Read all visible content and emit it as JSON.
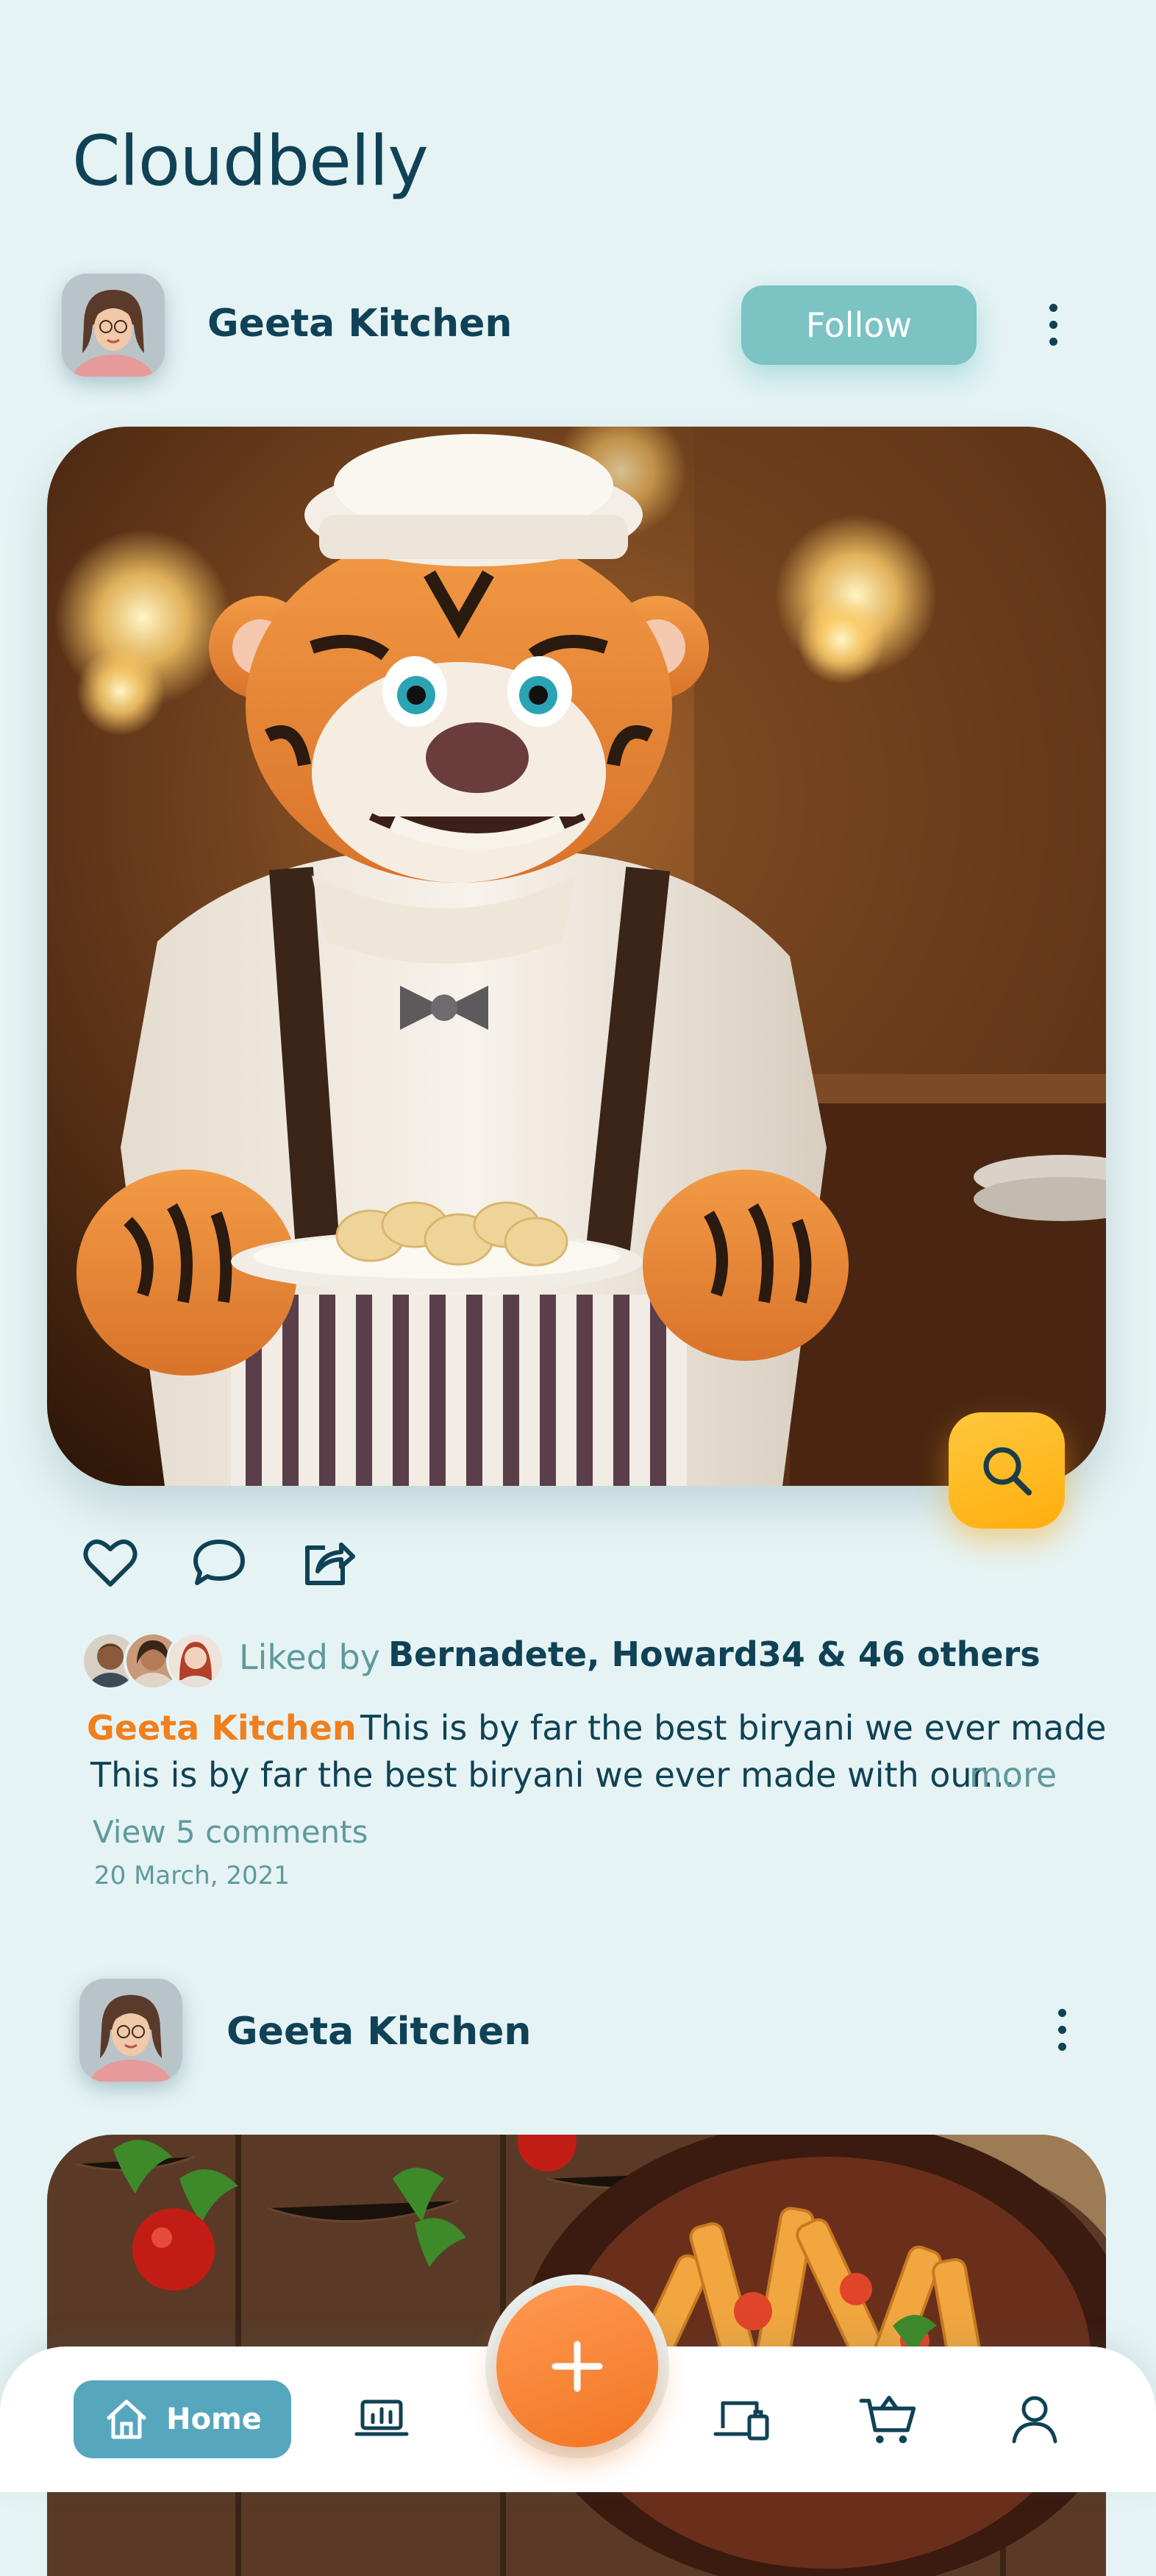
{
  "app": {
    "title": "Cloudbelly"
  },
  "post1": {
    "author": "Geeta Kitchen",
    "follow_label": "Follow",
    "likes": {
      "prefix": "Liked by",
      "names": "Bernadete, Howard34 & 46 others"
    },
    "caption": {
      "author": "Geeta Kitchen",
      "title": "This is by far the best biryani we ever made",
      "body": "This is by far the best biryani we ever made with our...",
      "more": "more"
    },
    "comments_link": "View 5 comments",
    "date": "20 March, 2021"
  },
  "post2": {
    "author": "Geeta Kitchen"
  },
  "nav": {
    "home_label": "Home"
  },
  "colors": {
    "background": "#e6f3f4",
    "primary_text": "#0f4256",
    "accent_orange": "#f07f1d",
    "follow_button": "#7cc3c4",
    "search_fab": "#ffb81f",
    "home_pill": "#56a7be"
  },
  "icons": [
    "more-vertical-icon",
    "heart-icon",
    "comment-icon",
    "share-icon",
    "search-icon",
    "home-icon",
    "laptop-chart-icon",
    "plus-icon",
    "devices-icon",
    "cart-icon",
    "user-icon"
  ]
}
